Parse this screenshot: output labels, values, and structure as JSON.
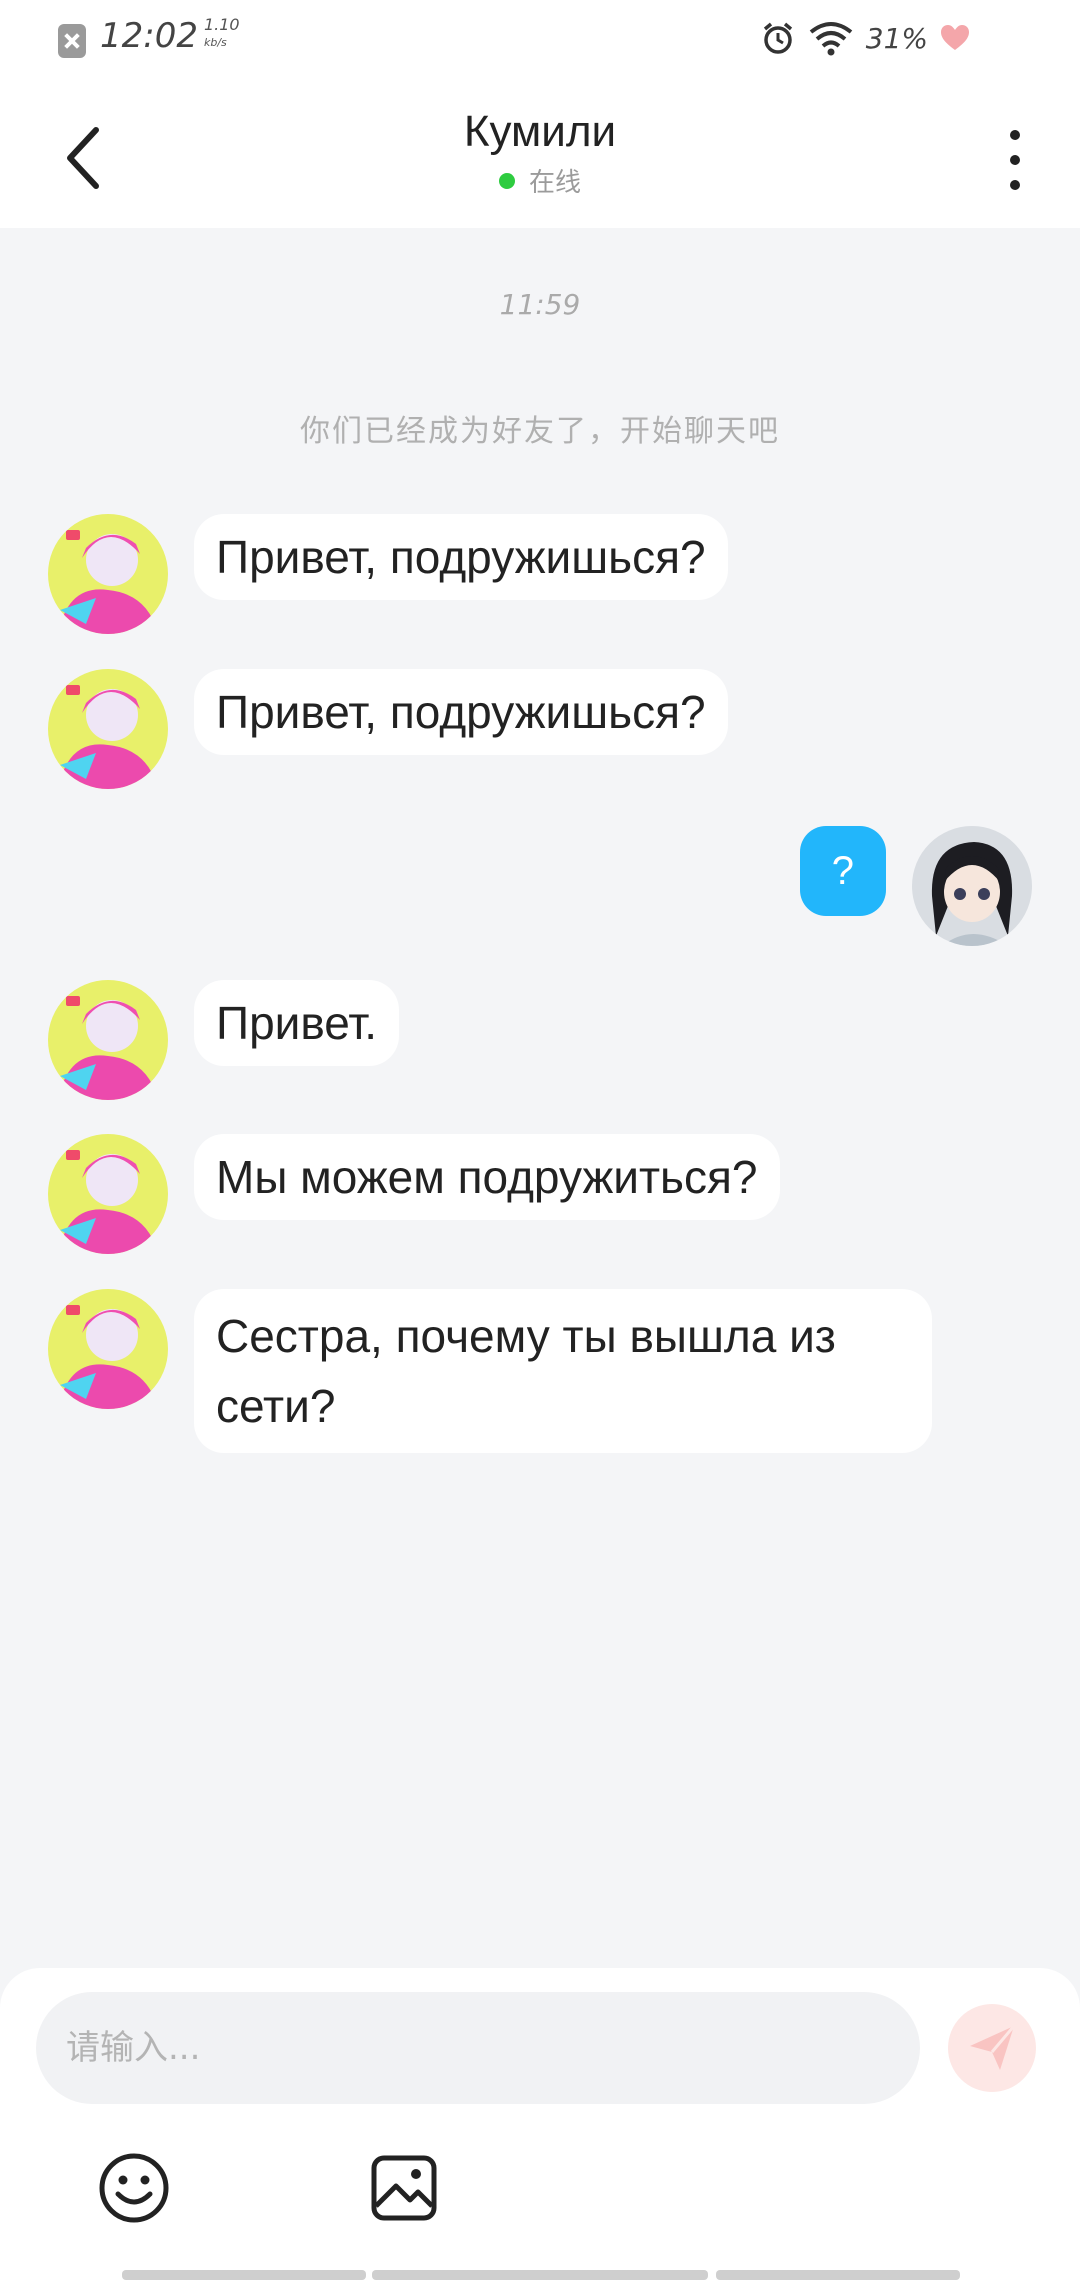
{
  "status_bar": {
    "time": "12:02",
    "net_speed_value": "1.10",
    "net_speed_unit": "kb/s",
    "battery": "31%"
  },
  "header": {
    "title": "Кумили",
    "status": "在线"
  },
  "chat": {
    "timestamp": "11:59",
    "system_message": "你们已经成为好友了，开始聊天吧",
    "messages": [
      {
        "side": "left",
        "text": "Привет, подружишься?"
      },
      {
        "side": "left",
        "text": "Привет, подружишься?"
      },
      {
        "side": "right",
        "text": "?"
      },
      {
        "side": "left",
        "text": "Привет."
      },
      {
        "side": "left",
        "text": "Мы можем подружиться?"
      },
      {
        "side": "left",
        "text": "Сестра, почему ты вышла из сети?"
      }
    ]
  },
  "input": {
    "placeholder": "请输入..."
  },
  "colors": {
    "accent_blue": "#22b6fb",
    "online_green": "#2ecc40",
    "send_button_bg": "#fde7e5",
    "background": "#f4f5f7"
  },
  "icons": {
    "back": "back-arrow-icon",
    "more": "more-vertical-icon",
    "send": "send-icon",
    "emoji": "emoji-icon",
    "image": "image-icon"
  }
}
